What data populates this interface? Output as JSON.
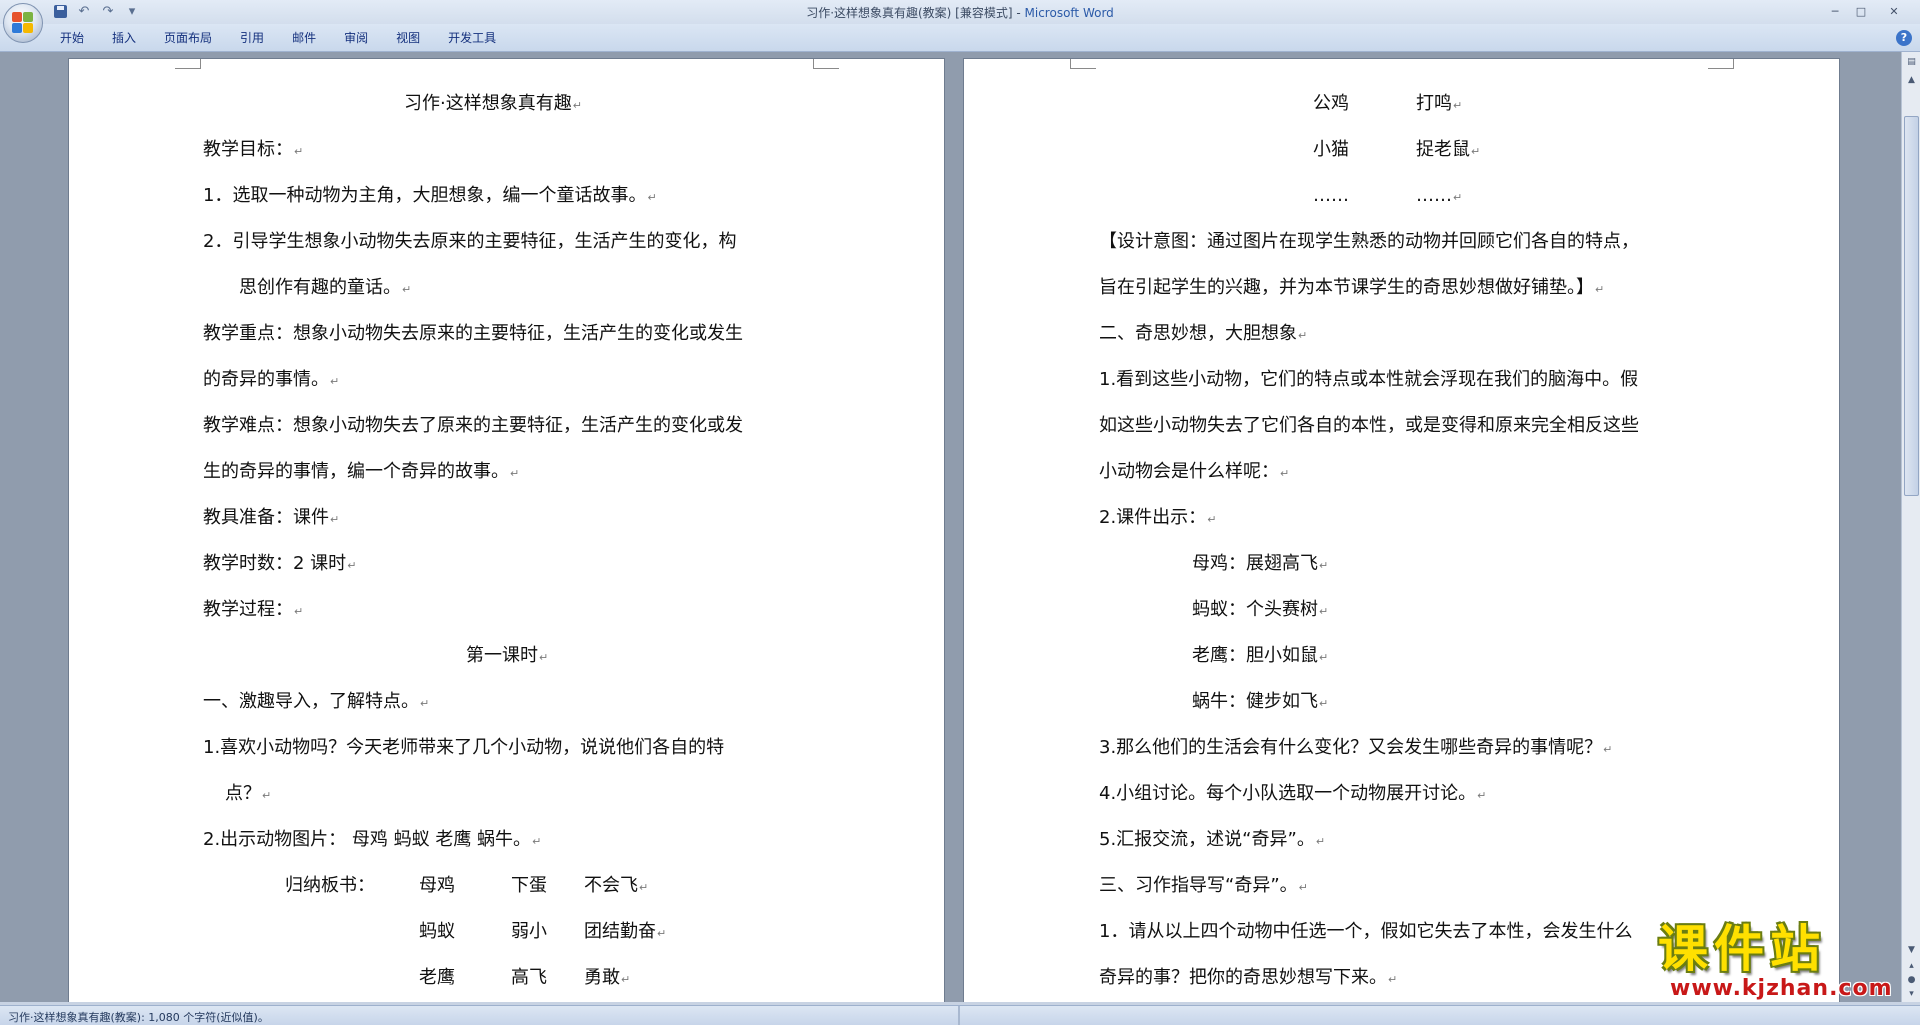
{
  "window": {
    "title": "习作·这样想象真有趣(教案) [兼容模式]",
    "app_name": "Microsoft Word",
    "controls": {
      "minimize": "─",
      "maximize": "□",
      "close": "✕"
    }
  },
  "quick_access": {
    "undo": "↶",
    "redo": "↷",
    "customize": "▾"
  },
  "ribbon": {
    "tabs": [
      "开始",
      "插入",
      "页面布局",
      "引用",
      "邮件",
      "审阅",
      "视图",
      "开发工具"
    ],
    "help": "?"
  },
  "document": {
    "left_page": {
      "title": "习作·这样想象真有趣",
      "objectives_heading": "教学目标：",
      "objective_1": "1．选取一种动物为主角，大胆想象，编一个童话故事。",
      "objective_2_line1": "2．引导学生想象小动物失去原来的主要特征，生活产生的变化，构",
      "objective_2_line2": "思创作有趣的童话。",
      "key_point_line1": "教学重点：想象小动物失去原来的主要特征，生活产生的变化或发生",
      "key_point_line2": "的奇异的事情。",
      "difficulty_line1": "教学难点：想象小动物失去了原来的主要特征，生活产生的变化或发",
      "difficulty_line2": "生的奇异的事情，编一个奇异的故事。",
      "materials": "教具准备：课件",
      "hours": "教学时数：2 课时",
      "process": "教学过程：",
      "lesson_1": "第一课时",
      "section_1": "一、激趣导入，了解特点。",
      "item_1_line1": "1.喜欢小动物吗？今天老师带来了几个小动物，说说他们各自的特",
      "item_1_line2": "点？",
      "item_2": "2.出示动物图片：  母鸡   蚂蚁   老鹰   蜗牛。",
      "board_label": "归纳板书：",
      "board_rows": [
        {
          "animal": "母鸡",
          "trait": "下蛋",
          "extra": "不会飞"
        },
        {
          "animal": "蚂蚁",
          "trait": "弱小",
          "extra": "团结勤奋"
        },
        {
          "animal": "老鹰",
          "trait": "高飞",
          "extra": "勇敢"
        }
      ]
    },
    "right_page": {
      "board_rows": [
        {
          "animal": "公鸡",
          "trait": "打鸣"
        },
        {
          "animal": "小猫",
          "trait": "捉老鼠"
        },
        {
          "animal": "……",
          "trait": "……"
        }
      ],
      "design_line1": "【设计意图：通过图片在现学生熟悉的动物并回顾它们各自的特点，",
      "design_line2": "旨在引起学生的兴趣，并为本节课学生的奇思妙想做好铺垫。】",
      "section_2": "二、奇思妙想，大胆想象",
      "item_1_line1": "1.看到这些小动物，它们的特点或本性就会浮现在我们的脑海中。假",
      "item_1_line2": "如这些小动物失去了它们各自的本性，或是变得和原来完全相反这些",
      "item_1_line3": "小动物会是什么样呢：",
      "item_2": "2.课件出示：",
      "slides": [
        "母鸡：展翅高飞",
        "蚂蚁：个头赛树",
        "老鹰：胆小如鼠",
        "蜗牛：健步如飞"
      ],
      "item_3": "3.那么他们的生活会有什么变化？又会发生哪些奇异的事情呢？",
      "item_4": "4.小组讨论。每个小队选取一个动物展开讨论。",
      "item_5": "5.汇报交流，述说“奇异”。",
      "section_3": "三、习作指导写“奇异”。",
      "item_6_line1": "1．请从以上四个动物中任选一个，假如它失去了本性，会发生什么",
      "item_6_line2": "奇异的事？把你的奇思妙想写下来。"
    }
  },
  "status_bar": {
    "text": "习作·这样想象真有趣(教案): 1,080 个字符(近似值)。"
  },
  "watermark": {
    "logo": "课件站",
    "url": "www.kjzhan.com"
  },
  "colors": {
    "ribbon_tab_text": "#15317e",
    "app_name": "#2b5aa8",
    "watermark_yellow": "#ffe000",
    "watermark_red": "#c81818"
  }
}
